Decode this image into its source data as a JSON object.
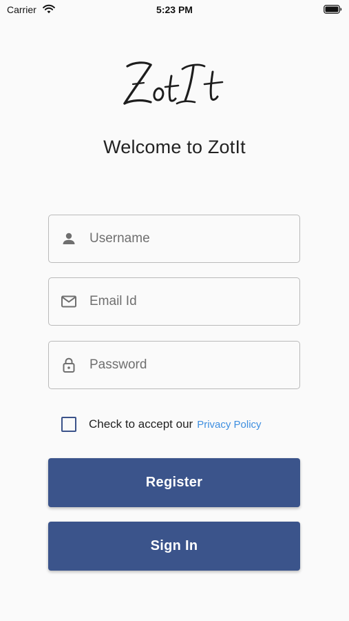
{
  "status_bar": {
    "carrier": "Carrier",
    "time": "5:23 PM",
    "icons": [
      "wifi-icon",
      "battery-icon"
    ]
  },
  "logo": {
    "text": "ZotIt",
    "style": "handwritten script"
  },
  "welcome_title": "Welcome to ZotIt",
  "form": {
    "username": {
      "placeholder": "Username",
      "value": "",
      "icon": "person-icon"
    },
    "email": {
      "placeholder": "Email Id",
      "value": "",
      "icon": "mail-icon"
    },
    "password": {
      "placeholder": "Password",
      "value": "",
      "icon": "lock-icon"
    },
    "privacy": {
      "checked": false,
      "label": "Check to accept our",
      "link_text": "Privacy Policy"
    }
  },
  "buttons": {
    "register": "Register",
    "sign_in": "Sign In"
  },
  "colors": {
    "background": "#fafafa",
    "primary": "#3b548b",
    "link": "#3d8ee0",
    "field_border": "#b9b9b9"
  }
}
